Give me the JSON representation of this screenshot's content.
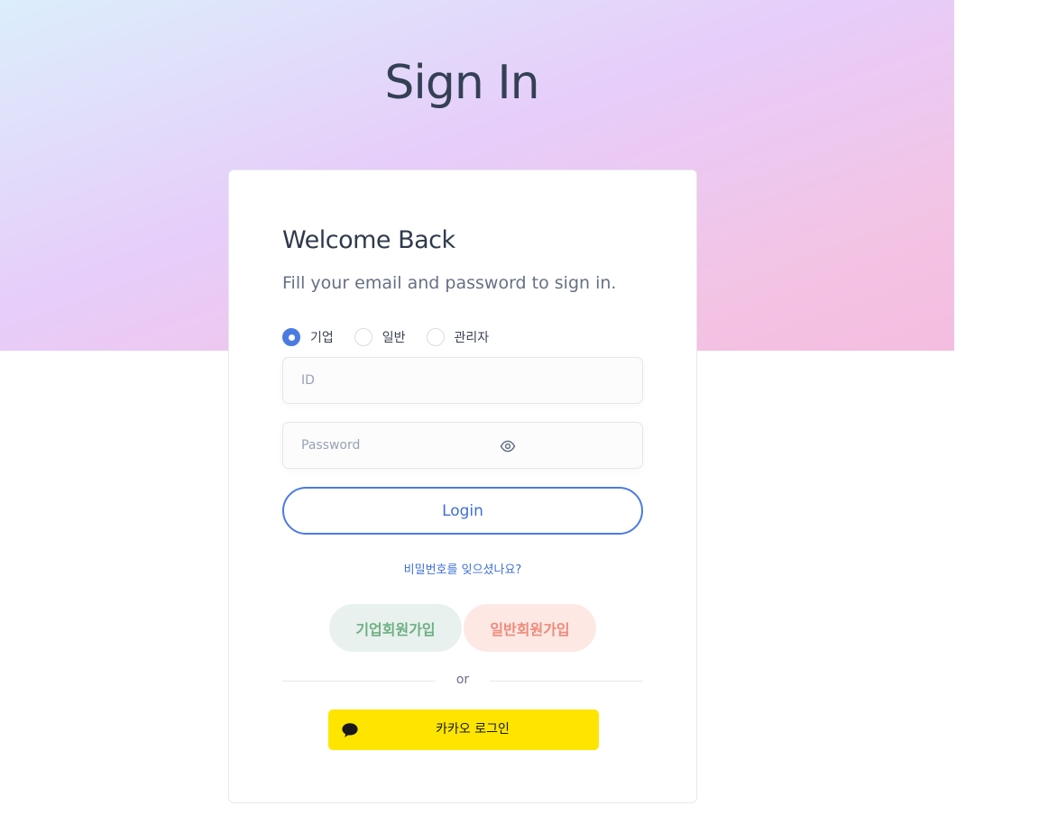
{
  "hero": {
    "title": "Sign In"
  },
  "card": {
    "heading": "Welcome Back",
    "subtitle": "Fill your email and password to sign in."
  },
  "user_type": {
    "options": [
      {
        "label": "기업",
        "selected": true
      },
      {
        "label": "일반",
        "selected": false
      },
      {
        "label": "관리자",
        "selected": false
      }
    ]
  },
  "form": {
    "id_placeholder": "ID",
    "password_placeholder": "Password"
  },
  "buttons": {
    "login": "Login",
    "forgot_password": "비밀번호를 잊으셨나요?",
    "signup_corporate": "기업회원가입",
    "signup_general": "일반회원가입",
    "divider": "or",
    "kakao_login": "카카오 로그인"
  },
  "colors": {
    "accent": "#4a7be0",
    "kakao": "#fee500",
    "signup_corporate_bg": "#e8f1ed",
    "signup_general_bg": "#fde8e4"
  },
  "icons": {
    "password_toggle": "eye-icon",
    "kakao": "speech-bubble-icon"
  }
}
